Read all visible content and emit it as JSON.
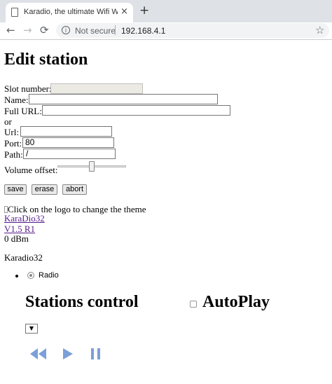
{
  "browser": {
    "tab_title": "Karadio, the ultimate Wifi Webradio",
    "tab_close": "×",
    "new_tab": "+",
    "back": "←",
    "forward": "→",
    "reload": "⟳",
    "info": "i",
    "security": "Not secure",
    "url": "192.168.4.1",
    "star": "☆"
  },
  "form": {
    "heading": "Edit station",
    "slot_label": "Slot number:",
    "slot_value": "",
    "name_label": "Name:",
    "name_value": "",
    "full_url_label": "Full URL:",
    "full_url_value": "",
    "or_label": "or",
    "url_label": "Url:",
    "url_value": "",
    "port_label": "Port:",
    "port_value": "80",
    "path_label": "Path:",
    "path_value": "/",
    "volume_label": "Volume offset:",
    "volume_offset_position": 0.5,
    "save": "save",
    "erase": "erase",
    "abort": "abort"
  },
  "info": {
    "logo_alt": "Click on the logo to change the theme",
    "project_link": "KaraDio32",
    "version_link": "V1.5 R1",
    "signal": "0 dBm",
    "device_name": "Karadio32"
  },
  "mode": {
    "radio_label": "Radio"
  },
  "stations": {
    "heading": "Stations control",
    "autoplay_label": "AutoPlay",
    "select_arrow": "▼"
  },
  "colors": {
    "control_blue": "#7b9fd8",
    "link": "#551a8b"
  }
}
